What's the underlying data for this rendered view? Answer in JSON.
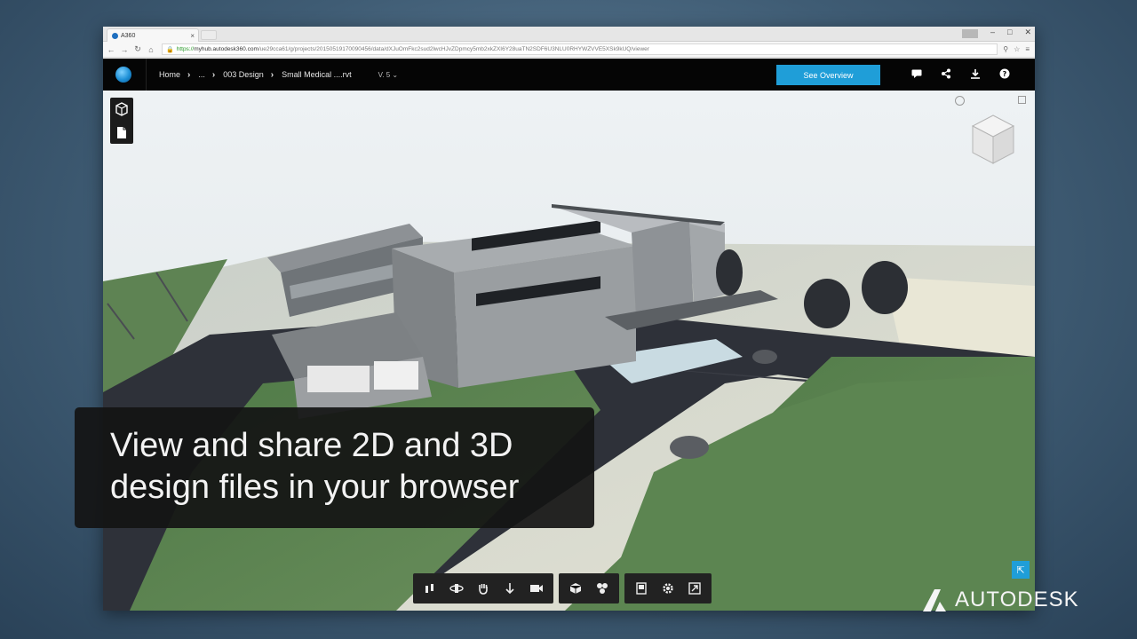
{
  "browser": {
    "tab_title": "A360",
    "tab_close": "×",
    "url_secure": "https://",
    "url_host": "myhub.autodesk360.com",
    "url_path": "/ue29cca61/g/projects/20150519170090456/data/dXJuOmFkc2sud2lwcHJvZDpmcy5mb2xkZXI6Y28uaTN2SDF6U3NLU0RHYWZVVE5XSk9kUQ/viewer"
  },
  "header": {
    "breadcrumbs": [
      "Home",
      "...",
      "003 Design",
      "Small Medical ....rvt"
    ],
    "version": "V. 5",
    "overview_button": "See Overview"
  },
  "caption": {
    "line1": "View and share 2D and 3D",
    "line2": "design files in your browser"
  },
  "brand": {
    "name": "AUTODESK"
  },
  "colors": {
    "accent": "#1f9ed8",
    "header_bg": "#050505",
    "grass": "#4f7a45",
    "road": "#2d3038"
  }
}
